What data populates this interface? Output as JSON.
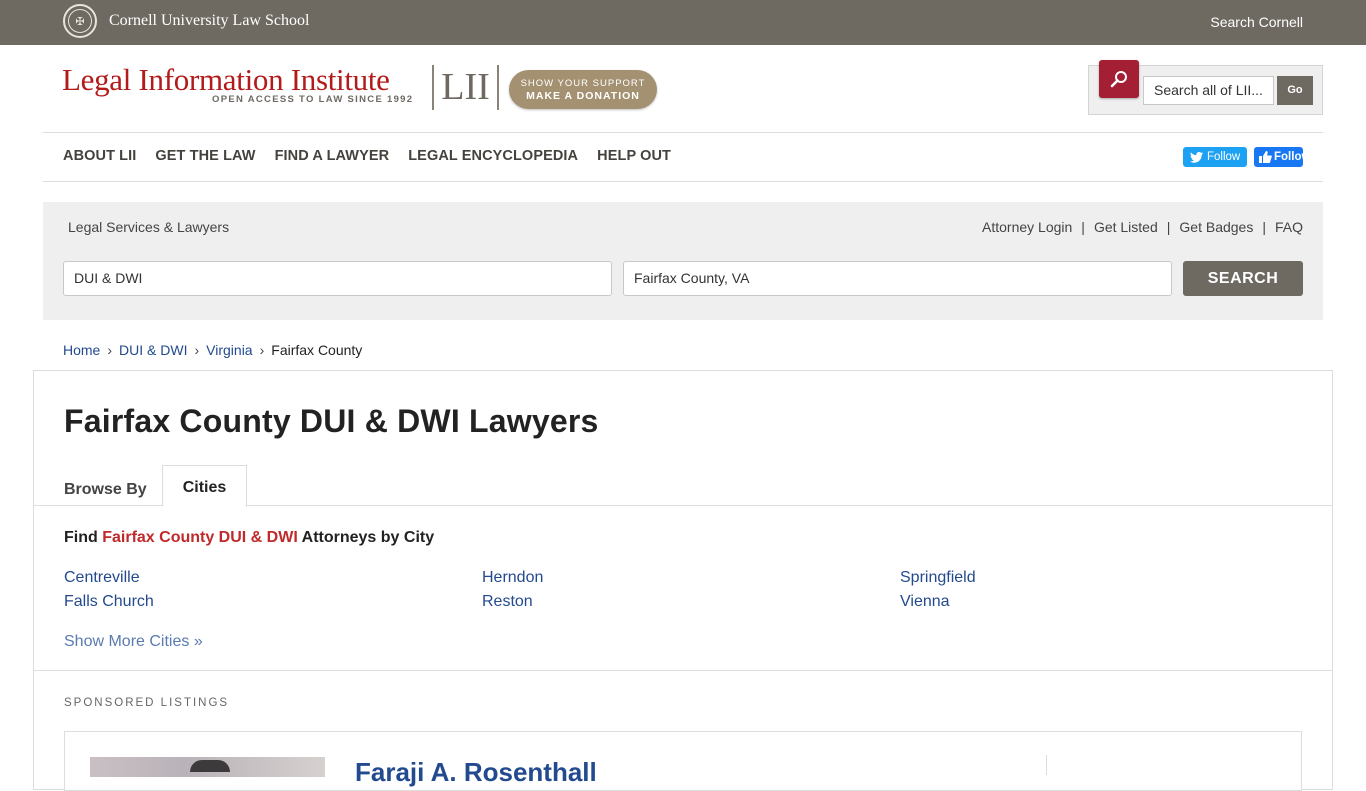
{
  "cornell_bar": {
    "name": "Cornell University Law School",
    "search_link": "Search Cornell"
  },
  "header": {
    "logo_title": "Legal Information Institute",
    "logo_subtitle": "OPEN ACCESS TO LAW SINCE 1992",
    "logo_mark": "LII",
    "donate_line1": "SHOW YOUR SUPPORT",
    "donate_line2": "MAKE A DONATION",
    "search_placeholder": "Search all of LII...",
    "go_label": "Go"
  },
  "nav": {
    "items": [
      "ABOUT LII",
      "GET THE LAW",
      "FIND A LAWYER",
      "LEGAL ENCYCLOPEDIA",
      "HELP OUT"
    ],
    "twitter_label": "Follow",
    "facebook_label": "Follow"
  },
  "legal_services": {
    "title": "Legal Services & Lawyers",
    "links": [
      "Attorney Login",
      "Get Listed",
      "Get Badges",
      "FAQ"
    ],
    "separator": "|",
    "practice_value": "DUI & DWI",
    "location_value": "Fairfax County, VA",
    "search_label": "SEARCH"
  },
  "breadcrumb": {
    "items": [
      "Home",
      "DUI & DWI",
      "Virginia"
    ],
    "current": "Fairfax County",
    "separator": "›"
  },
  "main": {
    "title": "Fairfax County DUI & DWI Lawyers",
    "browse_by": "Browse By",
    "tab_cities": "Cities",
    "find_prefix": "Find",
    "find_highlight": "Fairfax County DUI & DWI",
    "find_suffix": "Attorneys by City",
    "cities": [
      "Centreville",
      "Falls Church",
      "Herndon",
      "Reston",
      "Springfield",
      "Vienna"
    ],
    "show_more": "Show More Cities »",
    "sponsored_label": "SPONSORED LISTINGS",
    "listing_name": "Faraji A. Rosenthall"
  }
}
